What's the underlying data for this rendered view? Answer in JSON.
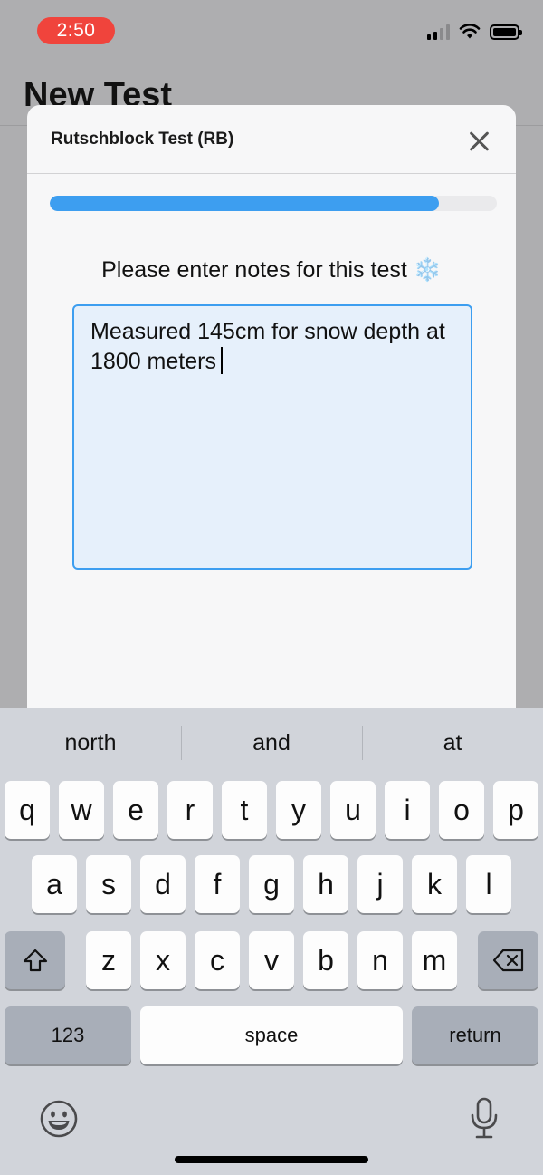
{
  "status_bar": {
    "time": "2:50"
  },
  "background_page": {
    "title": "New Test"
  },
  "modal": {
    "title": "Rutschblock Test (RB)",
    "progress": 0.87,
    "prompt": "Please enter notes for this test",
    "prompt_emoji": "❄️",
    "notes_value": "Measured 145cm for snow depth at 1800 meters"
  },
  "keyboard": {
    "suggestions": [
      "north",
      "and",
      "at"
    ],
    "row1": [
      "q",
      "w",
      "e",
      "r",
      "t",
      "y",
      "u",
      "i",
      "o",
      "p"
    ],
    "row2": [
      "a",
      "s",
      "d",
      "f",
      "g",
      "h",
      "j",
      "k",
      "l"
    ],
    "row3": [
      "z",
      "x",
      "c",
      "v",
      "b",
      "n",
      "m"
    ],
    "numbers_label": "123",
    "space_label": "space",
    "return_label": "return"
  },
  "colors": {
    "accent": "#3d9ef0",
    "time_pill": "#f0443c",
    "input_bg": "#e6f0fb"
  }
}
